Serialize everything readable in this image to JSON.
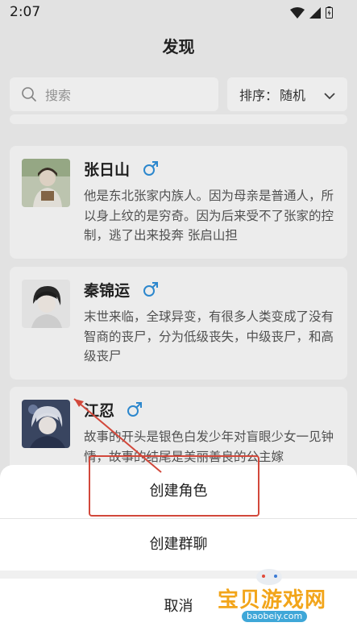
{
  "status_bar": {
    "time": "2:07"
  },
  "page": {
    "title": "发现"
  },
  "search": {
    "placeholder": "搜索"
  },
  "sort": {
    "label": "排序：",
    "value": "随机"
  },
  "characters": [
    {
      "name": "张日山",
      "gender": "male",
      "description": "他是东北张家内族人。因为母亲是普通人，所以身上纹的是穷奇。因为后来受不了张家的控制，逃了出来投奔 张启山担"
    },
    {
      "name": "秦锦运",
      "gender": "male",
      "description": "末世来临，全球异变，有很多人类变成了没有智商的丧尸，分为低级丧失，中级丧尸，和高级丧尸"
    },
    {
      "name": "江忍",
      "gender": "male",
      "description": "故事的开头是银色白发少年对盲眼少女一见钟情，故事的结尾是美丽善良的公主嫁"
    }
  ],
  "action_sheet": {
    "create_role": "创建角色",
    "create_group": "创建群聊",
    "cancel": "取消"
  },
  "watermark": {
    "text": "宝贝游戏网",
    "url": "baobeiy.com"
  },
  "colors": {
    "highlight": "#d2483b",
    "gender_male": "#2f8fd8",
    "watermark": "#f2a51a"
  }
}
